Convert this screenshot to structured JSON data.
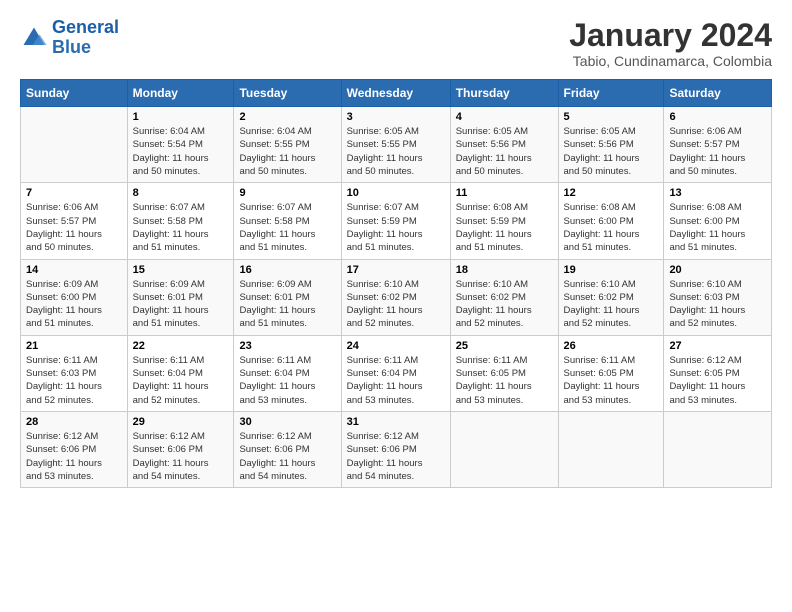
{
  "logo": {
    "line1": "General",
    "line2": "Blue"
  },
  "title": "January 2024",
  "subtitle": "Tabio, Cundinamarca, Colombia",
  "days_of_week": [
    "Sunday",
    "Monday",
    "Tuesday",
    "Wednesday",
    "Thursday",
    "Friday",
    "Saturday"
  ],
  "weeks": [
    [
      {
        "num": "",
        "info": ""
      },
      {
        "num": "1",
        "info": "Sunrise: 6:04 AM\nSunset: 5:54 PM\nDaylight: 11 hours\nand 50 minutes."
      },
      {
        "num": "2",
        "info": "Sunrise: 6:04 AM\nSunset: 5:55 PM\nDaylight: 11 hours\nand 50 minutes."
      },
      {
        "num": "3",
        "info": "Sunrise: 6:05 AM\nSunset: 5:55 PM\nDaylight: 11 hours\nand 50 minutes."
      },
      {
        "num": "4",
        "info": "Sunrise: 6:05 AM\nSunset: 5:56 PM\nDaylight: 11 hours\nand 50 minutes."
      },
      {
        "num": "5",
        "info": "Sunrise: 6:05 AM\nSunset: 5:56 PM\nDaylight: 11 hours\nand 50 minutes."
      },
      {
        "num": "6",
        "info": "Sunrise: 6:06 AM\nSunset: 5:57 PM\nDaylight: 11 hours\nand 50 minutes."
      }
    ],
    [
      {
        "num": "7",
        "info": "Sunrise: 6:06 AM\nSunset: 5:57 PM\nDaylight: 11 hours\nand 50 minutes."
      },
      {
        "num": "8",
        "info": "Sunrise: 6:07 AM\nSunset: 5:58 PM\nDaylight: 11 hours\nand 51 minutes."
      },
      {
        "num": "9",
        "info": "Sunrise: 6:07 AM\nSunset: 5:58 PM\nDaylight: 11 hours\nand 51 minutes."
      },
      {
        "num": "10",
        "info": "Sunrise: 6:07 AM\nSunset: 5:59 PM\nDaylight: 11 hours\nand 51 minutes."
      },
      {
        "num": "11",
        "info": "Sunrise: 6:08 AM\nSunset: 5:59 PM\nDaylight: 11 hours\nand 51 minutes."
      },
      {
        "num": "12",
        "info": "Sunrise: 6:08 AM\nSunset: 6:00 PM\nDaylight: 11 hours\nand 51 minutes."
      },
      {
        "num": "13",
        "info": "Sunrise: 6:08 AM\nSunset: 6:00 PM\nDaylight: 11 hours\nand 51 minutes."
      }
    ],
    [
      {
        "num": "14",
        "info": "Sunrise: 6:09 AM\nSunset: 6:00 PM\nDaylight: 11 hours\nand 51 minutes."
      },
      {
        "num": "15",
        "info": "Sunrise: 6:09 AM\nSunset: 6:01 PM\nDaylight: 11 hours\nand 51 minutes."
      },
      {
        "num": "16",
        "info": "Sunrise: 6:09 AM\nSunset: 6:01 PM\nDaylight: 11 hours\nand 51 minutes."
      },
      {
        "num": "17",
        "info": "Sunrise: 6:10 AM\nSunset: 6:02 PM\nDaylight: 11 hours\nand 52 minutes."
      },
      {
        "num": "18",
        "info": "Sunrise: 6:10 AM\nSunset: 6:02 PM\nDaylight: 11 hours\nand 52 minutes."
      },
      {
        "num": "19",
        "info": "Sunrise: 6:10 AM\nSunset: 6:02 PM\nDaylight: 11 hours\nand 52 minutes."
      },
      {
        "num": "20",
        "info": "Sunrise: 6:10 AM\nSunset: 6:03 PM\nDaylight: 11 hours\nand 52 minutes."
      }
    ],
    [
      {
        "num": "21",
        "info": "Sunrise: 6:11 AM\nSunset: 6:03 PM\nDaylight: 11 hours\nand 52 minutes."
      },
      {
        "num": "22",
        "info": "Sunrise: 6:11 AM\nSunset: 6:04 PM\nDaylight: 11 hours\nand 52 minutes."
      },
      {
        "num": "23",
        "info": "Sunrise: 6:11 AM\nSunset: 6:04 PM\nDaylight: 11 hours\nand 53 minutes."
      },
      {
        "num": "24",
        "info": "Sunrise: 6:11 AM\nSunset: 6:04 PM\nDaylight: 11 hours\nand 53 minutes."
      },
      {
        "num": "25",
        "info": "Sunrise: 6:11 AM\nSunset: 6:05 PM\nDaylight: 11 hours\nand 53 minutes."
      },
      {
        "num": "26",
        "info": "Sunrise: 6:11 AM\nSunset: 6:05 PM\nDaylight: 11 hours\nand 53 minutes."
      },
      {
        "num": "27",
        "info": "Sunrise: 6:12 AM\nSunset: 6:05 PM\nDaylight: 11 hours\nand 53 minutes."
      }
    ],
    [
      {
        "num": "28",
        "info": "Sunrise: 6:12 AM\nSunset: 6:06 PM\nDaylight: 11 hours\nand 53 minutes."
      },
      {
        "num": "29",
        "info": "Sunrise: 6:12 AM\nSunset: 6:06 PM\nDaylight: 11 hours\nand 54 minutes."
      },
      {
        "num": "30",
        "info": "Sunrise: 6:12 AM\nSunset: 6:06 PM\nDaylight: 11 hours\nand 54 minutes."
      },
      {
        "num": "31",
        "info": "Sunrise: 6:12 AM\nSunset: 6:06 PM\nDaylight: 11 hours\nand 54 minutes."
      },
      {
        "num": "",
        "info": ""
      },
      {
        "num": "",
        "info": ""
      },
      {
        "num": "",
        "info": ""
      }
    ]
  ]
}
